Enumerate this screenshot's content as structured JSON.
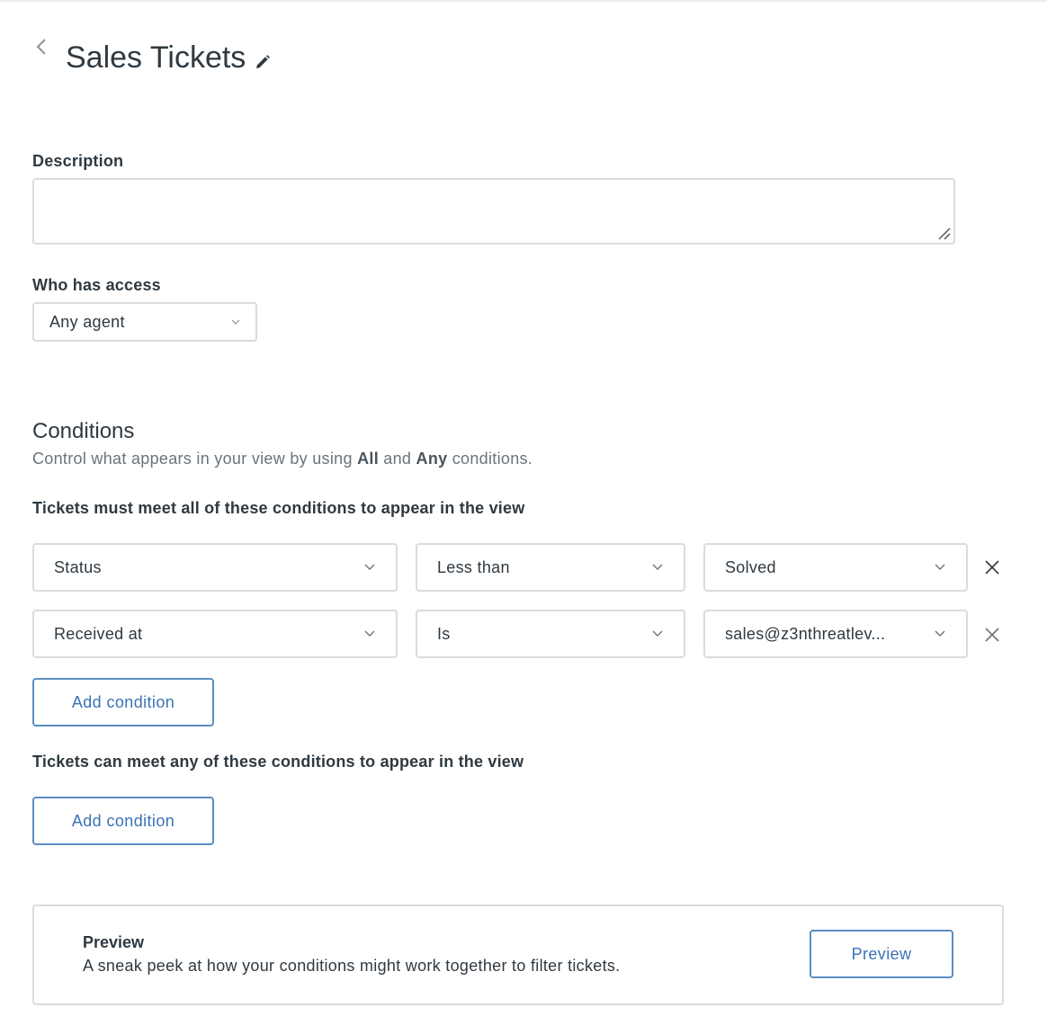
{
  "header": {
    "title": "Sales Tickets",
    "back_icon": "chevron-left-icon",
    "edit_icon": "pencil-icon"
  },
  "description": {
    "label": "Description",
    "value": "",
    "placeholder": ""
  },
  "access": {
    "label": "Who has access",
    "selected": "Any agent"
  },
  "conditions": {
    "title": "Conditions",
    "desc_prefix": "Control what appears in your view by using ",
    "desc_all": "All",
    "desc_and": " and ",
    "desc_any": "Any",
    "desc_suffix": " conditions.",
    "all_heading": "Tickets must meet all of these conditions to appear in the view",
    "all_rows": [
      {
        "field": "Status",
        "operator": "Less than",
        "value": "Solved"
      },
      {
        "field": "Received at",
        "operator": "Is",
        "value": "sales@z3nthreatlev..."
      }
    ],
    "all_add_label": "Add condition",
    "any_heading": "Tickets can meet any of these conditions to appear in the view",
    "any_add_label": "Add condition"
  },
  "preview": {
    "title": "Preview",
    "description": "A sneak peek at how your conditions might work together to filter tickets.",
    "button_label": "Preview"
  },
  "colors": {
    "accent": "#3a73b6",
    "accent_border": "#5b8ec4",
    "border": "#d8dcde",
    "text": "#2f3941",
    "muted_text": "#68737d"
  }
}
